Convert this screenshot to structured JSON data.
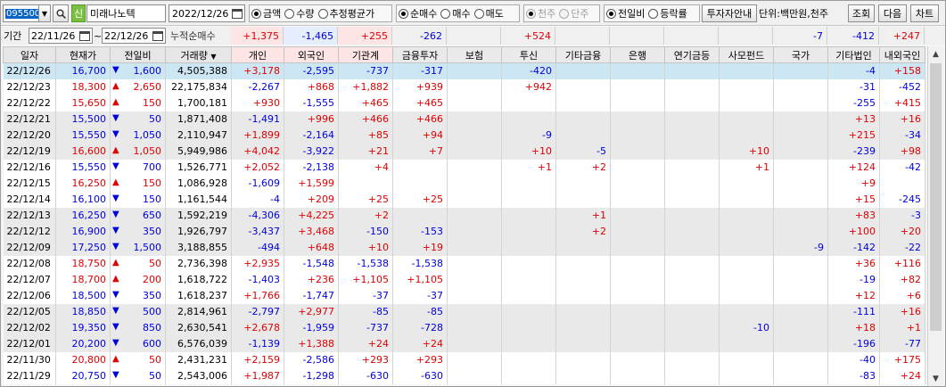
{
  "toolbar": {
    "code": "095500",
    "credit_badge": "신",
    "stock_name": "미래나노텍",
    "date": "2022/12/26",
    "options_amount": [
      "금액",
      "수량",
      "추정평균가"
    ],
    "options_amount_selected": 0,
    "options_trade": [
      "순매수",
      "매수",
      "매도"
    ],
    "options_trade_selected": 0,
    "options_unit": [
      "천주",
      "단주"
    ],
    "options_unit_selected": 0,
    "options_change": [
      "전일비",
      "등락률"
    ],
    "options_change_selected": 0,
    "investor_guide_label": "투자자안내",
    "unit_text": "단위:백만원,천주",
    "query_label": "조회",
    "next_label": "다음",
    "chart_label": "차트"
  },
  "period": {
    "label": "기간",
    "from": "22/11/26",
    "to": "22/12/26",
    "tilde": "~",
    "cum_label": "누적순매수",
    "totals": [
      "+1,375",
      "-1,465",
      "+255",
      "-262",
      "",
      "+524",
      "",
      "",
      "",
      "",
      "-7",
      "-412",
      "+247"
    ]
  },
  "table": {
    "headers": [
      "일자",
      "현재가",
      "전일비",
      "거래량",
      "개인",
      "외국인",
      "기관계",
      "금융투자",
      "보험",
      "투신",
      "기타금융",
      "은행",
      "연기금등",
      "사모펀드",
      "국가",
      "기타법인",
      "내외국인"
    ],
    "rows": [
      {
        "date": "22/12/26",
        "price": "16,700",
        "dir": "down",
        "change": "1,600",
        "volume": "4,505,388",
        "v": [
          "+3,178",
          "-2,595",
          "-737",
          "-317",
          "",
          "-420",
          "",
          "",
          "",
          "",
          "",
          "-4",
          "+158"
        ]
      },
      {
        "date": "22/12/23",
        "price": "18,300",
        "dir": "up",
        "change": "2,650",
        "volume": "22,175,834",
        "v": [
          "-2,267",
          "+868",
          "+1,882",
          "+939",
          "",
          "+942",
          "",
          "",
          "",
          "",
          "",
          "-31",
          "-452"
        ]
      },
      {
        "date": "22/12/22",
        "price": "15,650",
        "dir": "up",
        "change": "150",
        "volume": "1,700,181",
        "v": [
          "+930",
          "-1,555",
          "+465",
          "+465",
          "",
          "",
          "",
          "",
          "",
          "",
          "",
          "-255",
          "+415"
        ]
      },
      {
        "date": "22/12/21",
        "price": "15,500",
        "dir": "down",
        "change": "50",
        "volume": "1,871,408",
        "v": [
          "-1,491",
          "+996",
          "+466",
          "+466",
          "",
          "",
          "",
          "",
          "",
          "",
          "",
          "+13",
          "+16"
        ]
      },
      {
        "date": "22/12/20",
        "price": "15,550",
        "dir": "down",
        "change": "1,050",
        "volume": "2,110,947",
        "v": [
          "+1,899",
          "-2,164",
          "+85",
          "+94",
          "",
          "-9",
          "",
          "",
          "",
          "",
          "",
          "+215",
          "-34"
        ]
      },
      {
        "date": "22/12/19",
        "price": "16,600",
        "dir": "up",
        "change": "1,050",
        "volume": "5,949,986",
        "v": [
          "+4,042",
          "-3,922",
          "+21",
          "+7",
          "",
          "+10",
          "-5",
          "",
          "",
          "+10",
          "",
          "-239",
          "+98"
        ]
      },
      {
        "date": "22/12/16",
        "price": "15,550",
        "dir": "down",
        "change": "700",
        "volume": "1,526,771",
        "v": [
          "+2,052",
          "-2,138",
          "+4",
          "",
          "",
          "+1",
          "+2",
          "",
          "",
          "+1",
          "",
          "+124",
          "-42"
        ]
      },
      {
        "date": "22/12/15",
        "price": "16,250",
        "dir": "up",
        "change": "150",
        "volume": "1,086,928",
        "v": [
          "-1,609",
          "+1,599",
          "",
          "",
          "",
          "",
          "",
          "",
          "",
          "",
          "",
          "+9",
          ""
        ]
      },
      {
        "date": "22/12/14",
        "price": "16,100",
        "dir": "down",
        "change": "150",
        "volume": "1,161,544",
        "v": [
          "-4",
          "+209",
          "+25",
          "+25",
          "",
          "",
          "",
          "",
          "",
          "",
          "",
          "+15",
          "-245"
        ]
      },
      {
        "date": "22/12/13",
        "price": "16,250",
        "dir": "down",
        "change": "650",
        "volume": "1,592,219",
        "v": [
          "-4,306",
          "+4,225",
          "+2",
          "",
          "",
          "",
          "+1",
          "",
          "",
          "",
          "",
          "+83",
          "-3"
        ]
      },
      {
        "date": "22/12/12",
        "price": "16,900",
        "dir": "down",
        "change": "350",
        "volume": "1,926,797",
        "v": [
          "-3,437",
          "+3,468",
          "-150",
          "-153",
          "",
          "",
          "+2",
          "",
          "",
          "",
          "",
          "+100",
          "+20"
        ]
      },
      {
        "date": "22/12/09",
        "price": "17,250",
        "dir": "down",
        "change": "1,500",
        "volume": "3,188,855",
        "v": [
          "-494",
          "+648",
          "+10",
          "+19",
          "",
          "",
          "",
          "",
          "",
          "",
          "-9",
          "-142",
          "-22"
        ]
      },
      {
        "date": "22/12/08",
        "price": "18,750",
        "dir": "up",
        "change": "50",
        "volume": "2,736,398",
        "v": [
          "+2,935",
          "-1,548",
          "-1,538",
          "-1,538",
          "",
          "",
          "",
          "",
          "",
          "",
          "",
          "+36",
          "+116"
        ]
      },
      {
        "date": "22/12/07",
        "price": "18,700",
        "dir": "up",
        "change": "200",
        "volume": "1,618,722",
        "v": [
          "-1,403",
          "+236",
          "+1,105",
          "+1,105",
          "",
          "",
          "",
          "",
          "",
          "",
          "",
          "-19",
          "+82"
        ]
      },
      {
        "date": "22/12/06",
        "price": "18,500",
        "dir": "down",
        "change": "350",
        "volume": "1,618,237",
        "v": [
          "+1,766",
          "-1,747",
          "-37",
          "-37",
          "",
          "",
          "",
          "",
          "",
          "",
          "",
          "+12",
          "+6"
        ]
      },
      {
        "date": "22/12/05",
        "price": "18,850",
        "dir": "down",
        "change": "500",
        "volume": "2,814,961",
        "v": [
          "-2,797",
          "+2,977",
          "-85",
          "-85",
          "",
          "",
          "",
          "",
          "",
          "",
          "",
          "-111",
          "+16"
        ]
      },
      {
        "date": "22/12/02",
        "price": "19,350",
        "dir": "down",
        "change": "850",
        "volume": "2,630,541",
        "v": [
          "+2,678",
          "-1,959",
          "-737",
          "-728",
          "",
          "",
          "",
          "",
          "",
          "-10",
          "",
          "+18",
          "+1"
        ]
      },
      {
        "date": "22/12/01",
        "price": "20,200",
        "dir": "down",
        "change": "600",
        "volume": "6,576,039",
        "v": [
          "-1,139",
          "+1,388",
          "+24",
          "+24",
          "",
          "",
          "",
          "",
          "",
          "",
          "",
          "-196",
          "-77"
        ]
      },
      {
        "date": "22/11/30",
        "price": "20,800",
        "dir": "up",
        "change": "50",
        "volume": "2,431,231",
        "v": [
          "+2,159",
          "-2,586",
          "+293",
          "+293",
          "",
          "",
          "",
          "",
          "",
          "",
          "",
          "-40",
          "+175"
        ]
      },
      {
        "date": "22/11/29",
        "price": "20,750",
        "dir": "down",
        "change": "50",
        "volume": "2,543,006",
        "v": [
          "+1,987",
          "-1,298",
          "-630",
          "-630",
          "",
          "",
          "",
          "",
          "",
          "",
          "",
          "-83",
          "+24"
        ]
      }
    ]
  },
  "colors": {
    "up": "#e00000",
    "down": "#0000e0",
    "selected": "#cde6f4",
    "alt": "#e9e9e9"
  }
}
